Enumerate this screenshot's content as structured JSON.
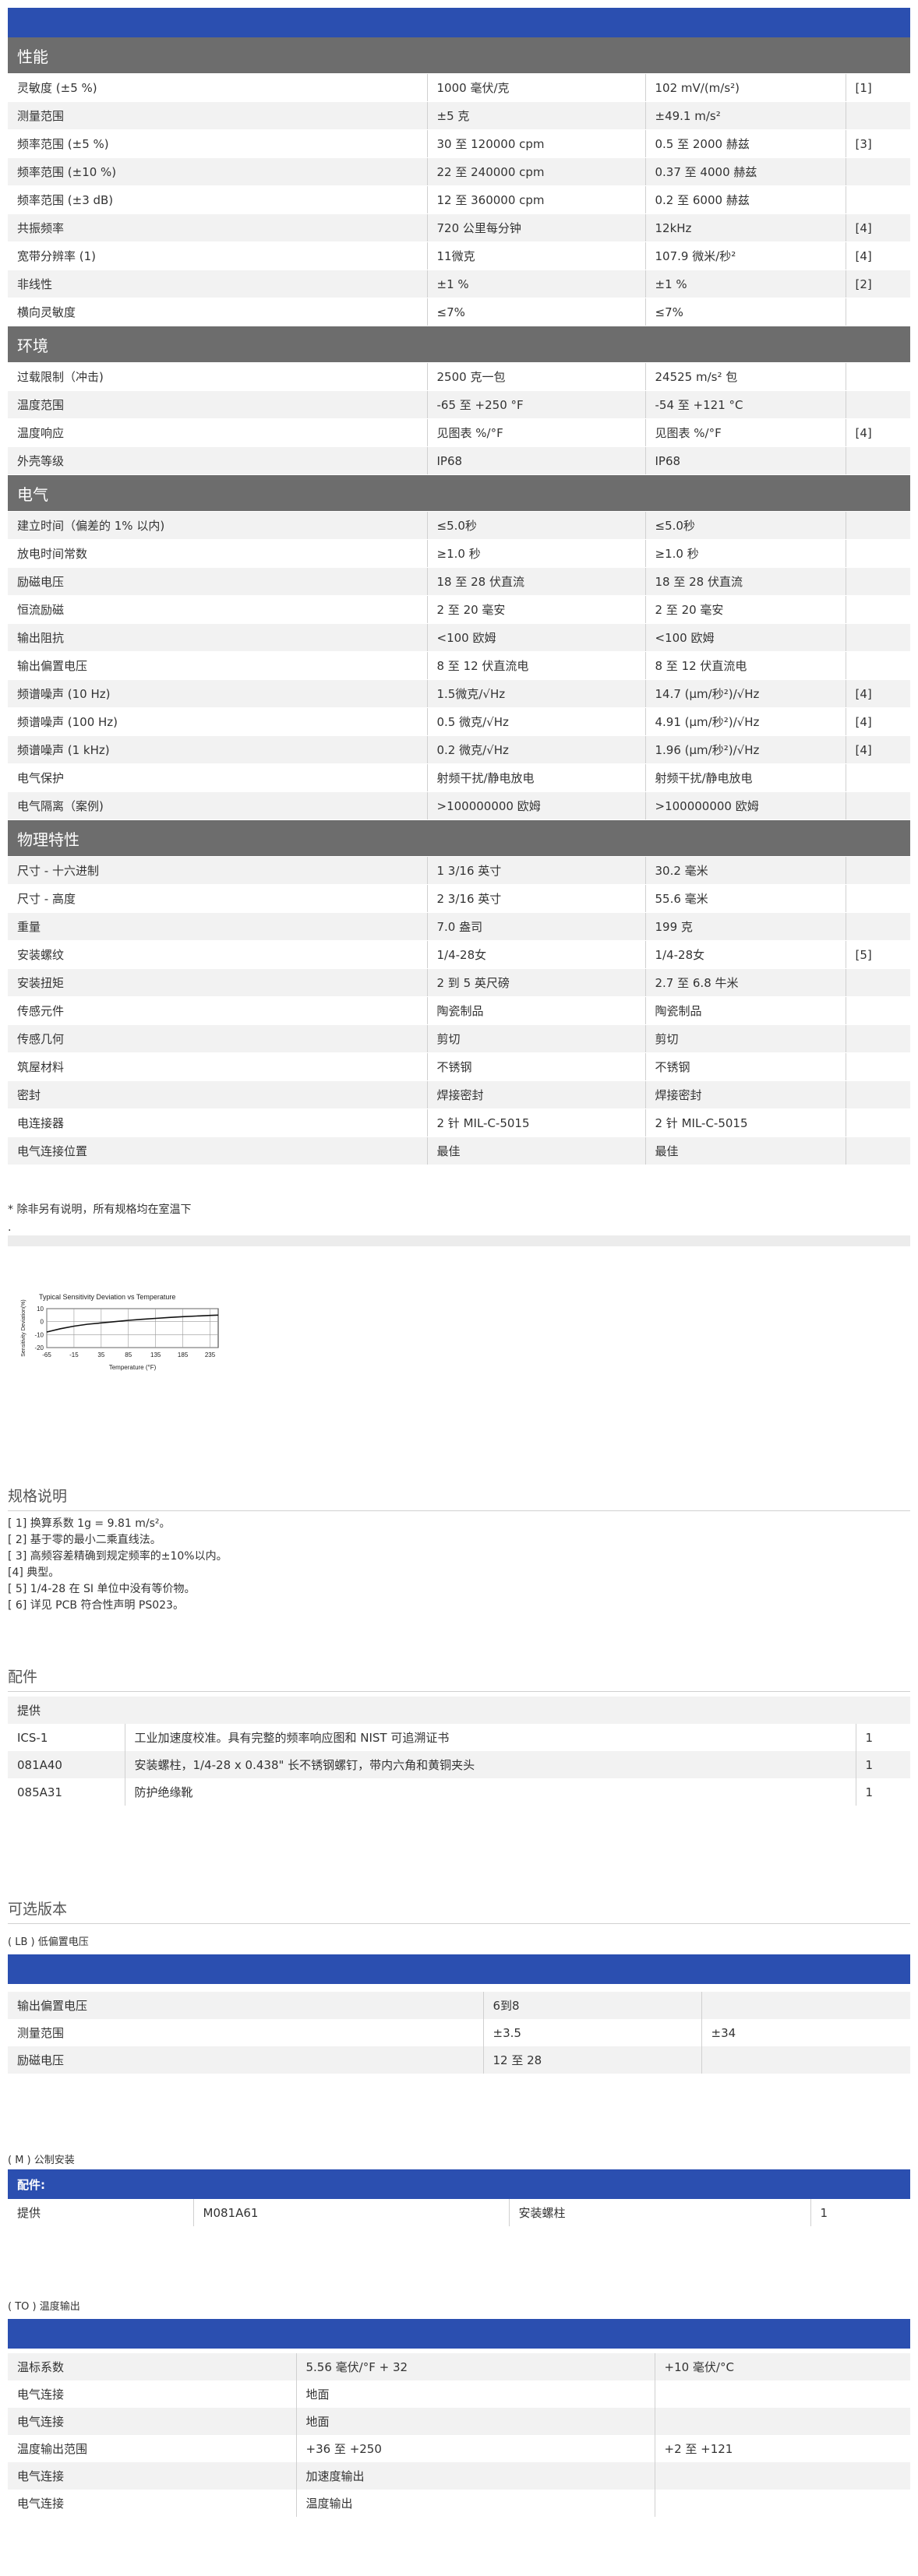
{
  "spec_sections": [
    {
      "title": "性能",
      "rows": [
        [
          "灵敏度 (±5 %)",
          "1000 毫伏/克",
          "102 mV/(m/s²)",
          "[1]"
        ],
        [
          "测量范围",
          "±5 克",
          "±49.1 m/s²",
          ""
        ],
        [
          "频率范围 (±5 %)",
          "30 至 120000 cpm",
          "0.5 至 2000 赫兹",
          "[3]"
        ],
        [
          "频率范围 (±10 %)",
          "22 至 240000 cpm",
          "0.37 至 4000 赫兹",
          ""
        ],
        [
          "频率范围 (±3 dB)",
          "12 至 360000 cpm",
          "0.2 至 6000 赫兹",
          ""
        ],
        [
          "共振频率",
          "720 公里每分钟",
          "12kHz",
          "[4]"
        ],
        [
          "宽带分辨率 (1)",
          "11微克",
          "107.9 微米/秒²",
          "[4]"
        ],
        [
          "非线性",
          "±1 %",
          "±1 %",
          "[2]"
        ],
        [
          "横向灵敏度",
          "≤7%",
          "≤7%",
          ""
        ]
      ]
    },
    {
      "title": "环境",
      "rows": [
        [
          "过载限制（冲击)",
          "2500 克一包",
          "24525 m/s² 包",
          ""
        ],
        [
          "温度范围",
          "-65 至 +250 °F",
          "-54 至 +121 °C",
          ""
        ],
        [
          "温度响应",
          "见图表 %/°F",
          "见图表 %/°F",
          "[4]"
        ],
        [
          "外壳等级",
          "IP68",
          "IP68",
          ""
        ]
      ]
    },
    {
      "title": "电气",
      "rows": [
        [
          "建立时间（偏差的 1% 以内)",
          "≤5.0秒",
          "≤5.0秒",
          ""
        ],
        [
          "放电时间常数",
          "≥1.0 秒",
          "≥1.0 秒",
          ""
        ],
        [
          "励磁电压",
          "18 至 28 伏直流",
          "18 至 28 伏直流",
          ""
        ],
        [
          "恒流励磁",
          "2 至 20 毫安",
          "2 至 20 毫安",
          ""
        ],
        [
          "输出阻抗",
          "<100 欧姆",
          "<100 欧姆",
          ""
        ],
        [
          "输出偏置电压",
          "8 至 12 伏直流电",
          "8 至 12 伏直流电",
          ""
        ],
        [
          "频谱噪声 (10 Hz)",
          "1.5微克/√Hz",
          "14.7 (μm/秒²)/√Hz",
          "[4]"
        ],
        [
          "频谱噪声 (100 Hz)",
          "0.5 微克/√Hz",
          "4.91 (μm/秒²)/√Hz",
          "[4]"
        ],
        [
          "频谱噪声 (1 kHz)",
          "0.2 微克/√Hz",
          "1.96 (μm/秒²)/√Hz",
          "[4]"
        ],
        [
          "电气保护",
          "射频干扰/静电放电",
          "射频干扰/静电放电",
          ""
        ],
        [
          "电气隔离（案例)",
          ">100000000 欧姆",
          ">100000000 欧姆",
          ""
        ]
      ]
    },
    {
      "title": "物理特性",
      "rows": [
        [
          "尺寸 - 十六进制",
          "1 3/16 英寸",
          "30.2 毫米",
          ""
        ],
        [
          "尺寸 - 高度",
          "2 3/16 英寸",
          "55.6 毫米",
          ""
        ],
        [
          "重量",
          "7.0 盎司",
          "199 克",
          ""
        ],
        [
          "安装螺纹",
          "1/4-28女",
          "1/4-28女",
          "[5]"
        ],
        [
          "安装扭矩",
          "2 到 5 英尺磅",
          "2.7 至 6.8 牛米",
          ""
        ],
        [
          "传感元件",
          "陶瓷制品",
          "陶瓷制品",
          ""
        ],
        [
          "传感几何",
          "剪切",
          "剪切",
          ""
        ],
        [
          "筑屋材料",
          "不锈钢",
          "不锈钢",
          ""
        ],
        [
          "密封",
          "焊接密封",
          "焊接密封",
          ""
        ],
        [
          "电连接器",
          "2 针 MIL-C-5015",
          "2 针 MIL-C-5015",
          ""
        ],
        [
          "电气连接位置",
          "最佳",
          "最佳",
          ""
        ]
      ]
    }
  ],
  "footnote": "* 除非另有说明，所有规格均在室温下",
  "dot": ".",
  "chart_data": {
    "type": "line",
    "title": "Typical Sensitivity Deviation vs Temperature",
    "xlabel": "Temperature (°F)",
    "ylabel": "Sensitivity Deviation(%)",
    "x_ticks": [
      "-65",
      "-15",
      "35",
      "85",
      "135",
      "185",
      "235"
    ],
    "y_ticks": [
      "10",
      "0",
      "-10",
      "-20"
    ],
    "xlim": [
      -65,
      250
    ],
    "ylim": [
      -20,
      10
    ],
    "x": [
      -65,
      -40,
      -15,
      10,
      35,
      60,
      85,
      110,
      135,
      160,
      185,
      210,
      235,
      250
    ],
    "values": [
      -8,
      -5.5,
      -3.5,
      -2,
      -1,
      0,
      1,
      1.8,
      2.5,
      3.2,
      3.8,
      4.3,
      4.8,
      5
    ],
    "grid": true
  },
  "notes": {
    "heading": "规格说明",
    "items": [
      "[ 1] 换算系数 1g = 9.81 m/s²。",
      "[ 2] 基于零的最小二乘直线法。",
      "[ 3] 高频容差精确到规定频率的±10%以内。",
      "[4] 典型。",
      "[ 5] 1/4-28 在 SI 单位中没有等价物。",
      "[ 6] 详见 PCB 符合性声明 PS023。"
    ]
  },
  "accessories": {
    "heading": "配件",
    "supply_label": "提供",
    "rows": [
      [
        "ICS-1",
        "工业加速度校准。具有完整的频率响应图和 NIST 可追溯证书",
        "1"
      ],
      [
        "081A40",
        "安装螺柱，1/4-28 x 0.438\" 长不锈钢螺钉，带内六角和黄铜夹头",
        "1"
      ],
      [
        "085A31",
        "防护绝缘靴",
        "1"
      ]
    ]
  },
  "options": {
    "heading": "可选版本",
    "lb": {
      "title": "( LB ) 低偏置电压",
      "rows": [
        [
          "输出偏置电压",
          "6到8",
          ""
        ],
        [
          "测量范围",
          "±3.5",
          "±34"
        ],
        [
          "励磁电压",
          "12 至 28",
          ""
        ]
      ]
    },
    "m": {
      "title": "( M ) 公制安装",
      "header": "配件:",
      "row": [
        "提供",
        "M081A61",
        "安装螺柱",
        "1"
      ]
    },
    "to": {
      "title": "( TO ) 温度输出",
      "rows": [
        [
          "温标系数",
          "5.56 毫伏/°F + 32",
          "+10 毫伏/°C"
        ],
        [
          "电气连接",
          "地面",
          ""
        ],
        [
          "电气连接",
          "地面",
          ""
        ],
        [
          "温度输出范围",
          "+36 至 +250",
          "+2 至 +121"
        ],
        [
          "电气连接",
          "加速度输出",
          ""
        ],
        [
          "电气连接",
          "温度输出",
          ""
        ]
      ]
    }
  }
}
